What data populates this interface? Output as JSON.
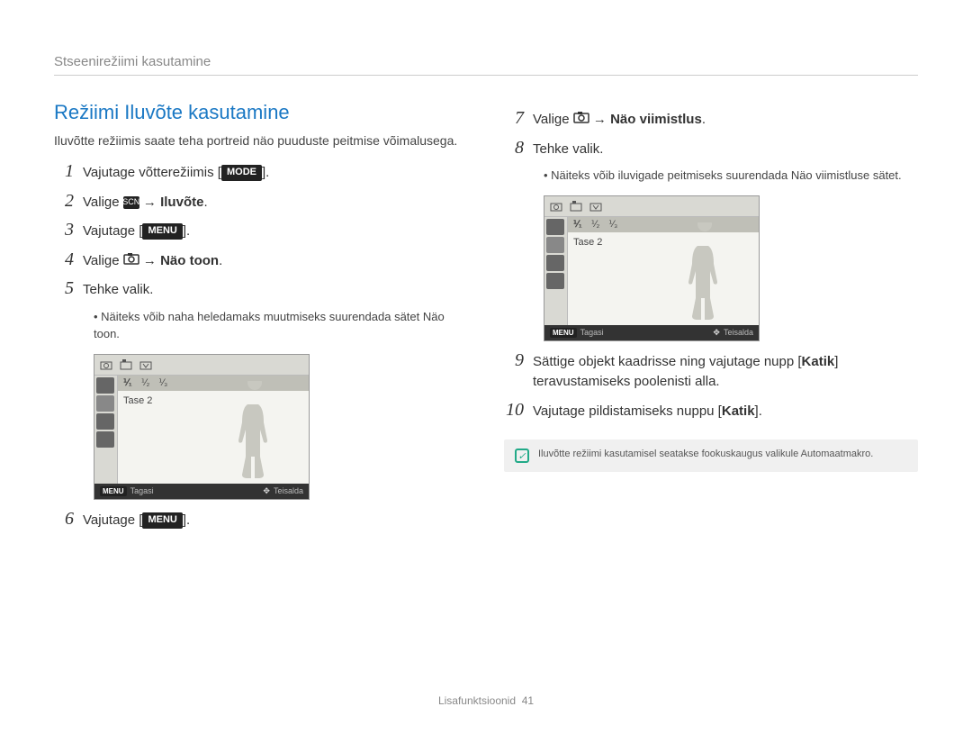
{
  "header": "Stseenirežiimi kasutamine",
  "section_title": "Režiimi Iluvõte kasutamine",
  "intro": "Iluvõtte režiimis saate teha portreid näo puuduste peitmise võimalusega.",
  "steps_left": [
    {
      "n": "1",
      "pre": "Vajutage võtterežiimis [",
      "btn": "MODE",
      "post": "]."
    },
    {
      "n": "2",
      "pre": "Valige ",
      "icon": "scene",
      "post_bold": " → Iluvõte",
      "post": "."
    },
    {
      "n": "3",
      "pre": "Vajutage [",
      "btn": "MENU",
      "post": "]."
    },
    {
      "n": "4",
      "pre": "Valige ",
      "icon": "camera",
      "post_bold": " → Näo toon",
      "post": "."
    },
    {
      "n": "5",
      "pre": "Tehke valik.",
      "btn": "",
      "post": ""
    }
  ],
  "note5": "Näiteks võib naha heledamaks muutmiseks suurendada sätet Näo toon.",
  "step6": {
    "n": "6",
    "pre": "Vajutage [",
    "btn": "MENU",
    "post": "]."
  },
  "steps_right": [
    {
      "n": "7",
      "pre": "Valige ",
      "icon": "camera",
      "post_bold": " → Näo viimistlus",
      "post": "."
    },
    {
      "n": "8",
      "pre": "Tehke valik.",
      "btn": "",
      "post": ""
    }
  ],
  "note8": "Näiteks võib iluvigade peitmiseks suurendada Näo viimistluse sätet.",
  "step9": {
    "n": "9",
    "text_pre": "Sättige objekt kaadrisse ning vajutage nupp [",
    "bold": "Katik",
    "text_post": "] teravustamiseks poolenisti alla."
  },
  "step10": {
    "n": "10",
    "text_pre": "Vajutage pildistamiseks nuppu [",
    "bold": "Katik",
    "text_post": "]."
  },
  "screenshot": {
    "tase": "Tase 2",
    "foot_left_btn": "MENU",
    "foot_left": "Tagasi",
    "foot_right": "Teisalda"
  },
  "info_note": "Iluvõtte režiimi kasutamisel seatakse fookuskaugus valikule Automaatmakro.",
  "footer_label": "Lisafunktsioonid",
  "footer_page": "41"
}
